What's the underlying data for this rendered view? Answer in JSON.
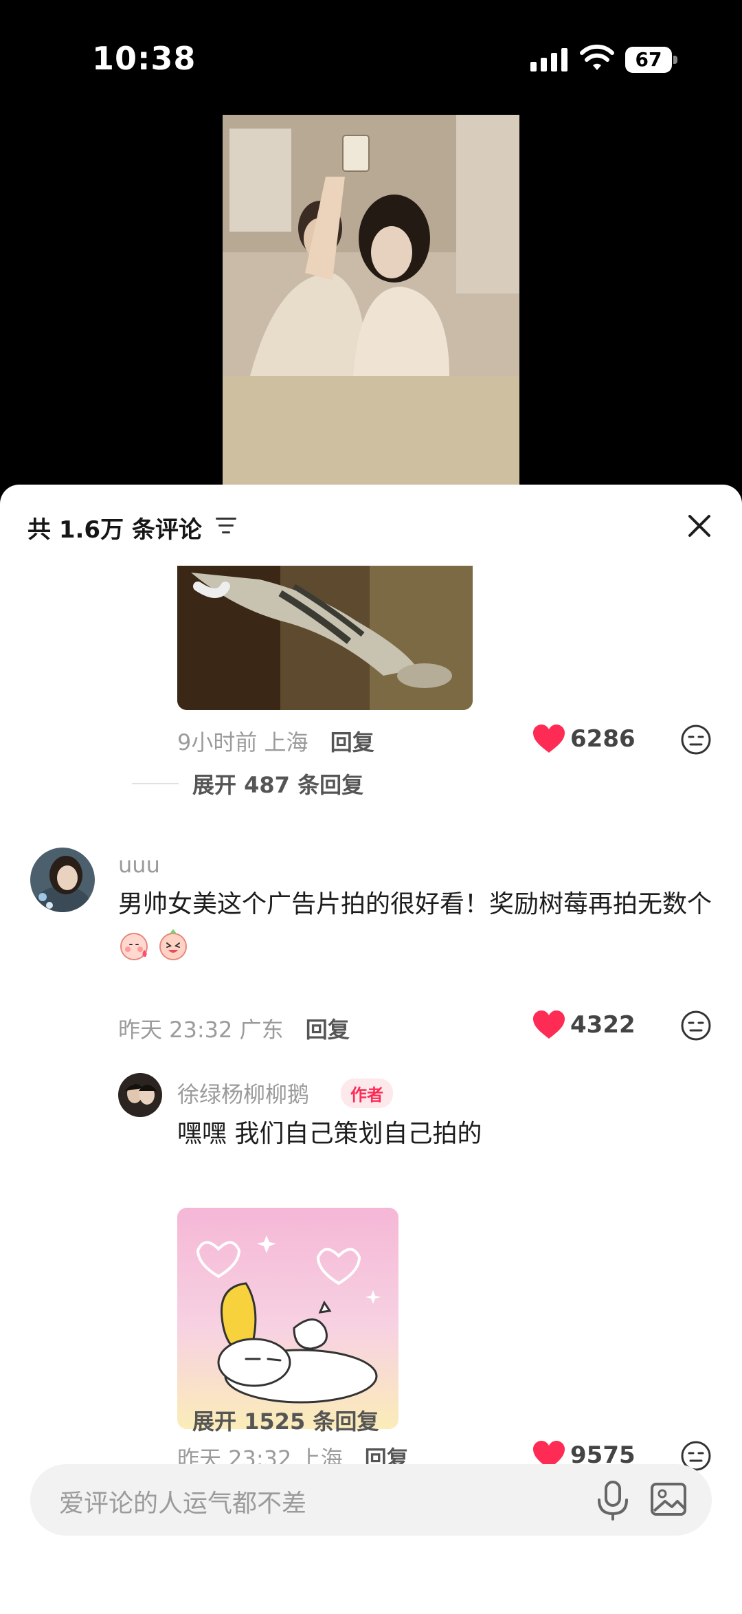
{
  "status_bar": {
    "time": "10:38",
    "battery": "67"
  },
  "comments_header": {
    "count_label": "共 1.6万 条评论"
  },
  "comments": [
    {
      "meta_time": "9小时前",
      "meta_location": "上海",
      "reply_label": "回复",
      "likes": "6286",
      "expand_label": "展开 487 条回复"
    },
    {
      "username": "uuu",
      "text": "男帅女美这个广告片拍的很好看！奖励树莓再拍无数个",
      "meta_time": "昨天 23:32",
      "meta_location": "广东",
      "reply_label": "回复",
      "likes": "4322"
    },
    {
      "username": "徐绿杨柳柳鹅",
      "badge": "作者",
      "text": "嘿嘿 我们自己策划自己拍的",
      "meta_time": "昨天 23:32",
      "meta_location": "上海",
      "reply_label": "回复",
      "likes": "9575",
      "expand_label": "展开 1525 条回复"
    }
  ],
  "input": {
    "placeholder": "爱评论的人运气都不差"
  },
  "colors": {
    "like_red": "#fe2c55",
    "sheet_bg": "#ffffff"
  }
}
